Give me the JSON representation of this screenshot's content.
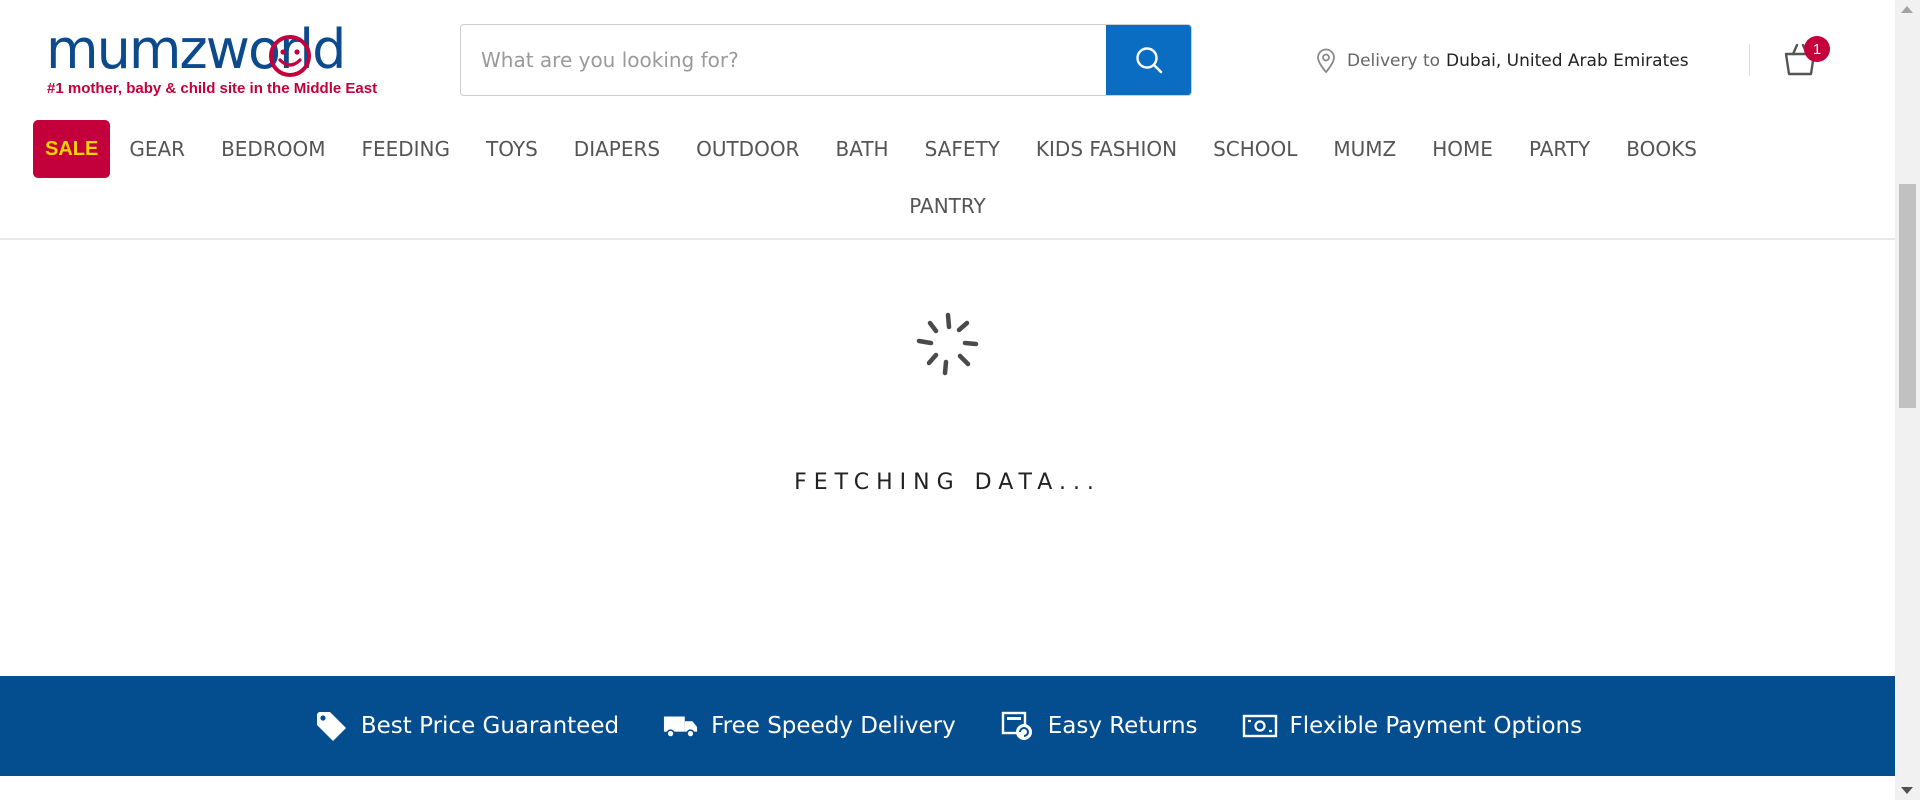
{
  "brand": {
    "name": "mumzworld",
    "tagline": "#1 mother, baby & child site in the Middle East",
    "primary_color": "#0c4a8e",
    "accent_color": "#c4003c"
  },
  "search": {
    "placeholder": "What are you looking for?",
    "value": "",
    "button_icon": "search-icon",
    "button_color": "#0a6dc2"
  },
  "delivery": {
    "icon": "location-pin-icon",
    "label": "Delivery to",
    "location": "Dubai, United Arab Emirates"
  },
  "cart": {
    "icon": "shopping-bag-icon",
    "count": "1"
  },
  "nav": {
    "sale_label": "SALE",
    "items": [
      "GEAR",
      "BEDROOM",
      "FEEDING",
      "TOYS",
      "DIAPERS",
      "OUTDOOR",
      "BATH",
      "SAFETY",
      "KIDS FASHION",
      "SCHOOL",
      "MUMZ",
      "HOME",
      "PARTY",
      "BOOKS",
      "PANTRY"
    ]
  },
  "loader": {
    "icon": "spinner-icon",
    "text": "FETCHING DATA..."
  },
  "trust_bar": {
    "background": "#044d8f",
    "items": [
      {
        "icon": "price-tag-icon",
        "label": "Best Price Guaranteed"
      },
      {
        "icon": "delivery-truck-icon",
        "label": "Free Speedy Delivery"
      },
      {
        "icon": "returns-icon",
        "label": "Easy Returns"
      },
      {
        "icon": "cash-icon",
        "label": "Flexible Payment Options"
      }
    ]
  }
}
